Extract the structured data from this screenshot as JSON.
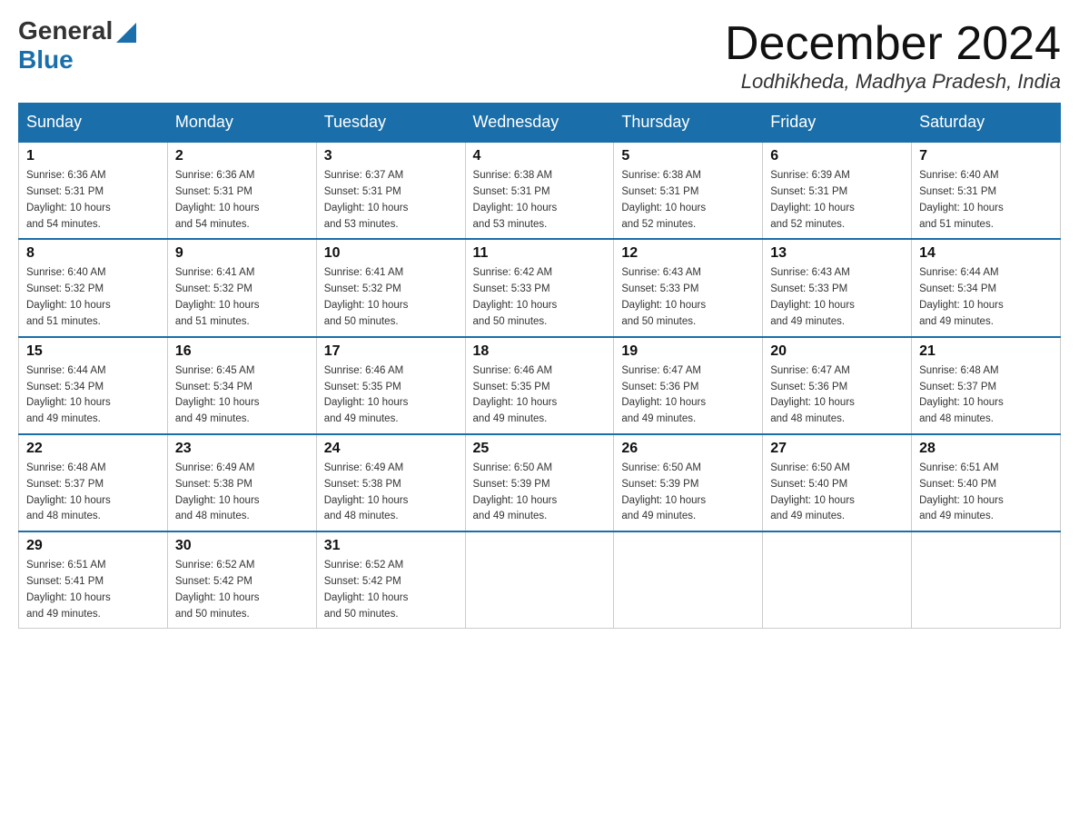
{
  "logo": {
    "general": "General",
    "blue": "Blue"
  },
  "title": "December 2024",
  "location": "Lodhikheda, Madhya Pradesh, India",
  "days_of_week": [
    "Sunday",
    "Monday",
    "Tuesday",
    "Wednesday",
    "Thursday",
    "Friday",
    "Saturday"
  ],
  "weeks": [
    [
      {
        "day": 1,
        "sunrise": "6:36 AM",
        "sunset": "5:31 PM",
        "daylight": "10 hours and 54 minutes."
      },
      {
        "day": 2,
        "sunrise": "6:36 AM",
        "sunset": "5:31 PM",
        "daylight": "10 hours and 54 minutes."
      },
      {
        "day": 3,
        "sunrise": "6:37 AM",
        "sunset": "5:31 PM",
        "daylight": "10 hours and 53 minutes."
      },
      {
        "day": 4,
        "sunrise": "6:38 AM",
        "sunset": "5:31 PM",
        "daylight": "10 hours and 53 minutes."
      },
      {
        "day": 5,
        "sunrise": "6:38 AM",
        "sunset": "5:31 PM",
        "daylight": "10 hours and 52 minutes."
      },
      {
        "day": 6,
        "sunrise": "6:39 AM",
        "sunset": "5:31 PM",
        "daylight": "10 hours and 52 minutes."
      },
      {
        "day": 7,
        "sunrise": "6:40 AM",
        "sunset": "5:31 PM",
        "daylight": "10 hours and 51 minutes."
      }
    ],
    [
      {
        "day": 8,
        "sunrise": "6:40 AM",
        "sunset": "5:32 PM",
        "daylight": "10 hours and 51 minutes."
      },
      {
        "day": 9,
        "sunrise": "6:41 AM",
        "sunset": "5:32 PM",
        "daylight": "10 hours and 51 minutes."
      },
      {
        "day": 10,
        "sunrise": "6:41 AM",
        "sunset": "5:32 PM",
        "daylight": "10 hours and 50 minutes."
      },
      {
        "day": 11,
        "sunrise": "6:42 AM",
        "sunset": "5:33 PM",
        "daylight": "10 hours and 50 minutes."
      },
      {
        "day": 12,
        "sunrise": "6:43 AM",
        "sunset": "5:33 PM",
        "daylight": "10 hours and 50 minutes."
      },
      {
        "day": 13,
        "sunrise": "6:43 AM",
        "sunset": "5:33 PM",
        "daylight": "10 hours and 49 minutes."
      },
      {
        "day": 14,
        "sunrise": "6:44 AM",
        "sunset": "5:34 PM",
        "daylight": "10 hours and 49 minutes."
      }
    ],
    [
      {
        "day": 15,
        "sunrise": "6:44 AM",
        "sunset": "5:34 PM",
        "daylight": "10 hours and 49 minutes."
      },
      {
        "day": 16,
        "sunrise": "6:45 AM",
        "sunset": "5:34 PM",
        "daylight": "10 hours and 49 minutes."
      },
      {
        "day": 17,
        "sunrise": "6:46 AM",
        "sunset": "5:35 PM",
        "daylight": "10 hours and 49 minutes."
      },
      {
        "day": 18,
        "sunrise": "6:46 AM",
        "sunset": "5:35 PM",
        "daylight": "10 hours and 49 minutes."
      },
      {
        "day": 19,
        "sunrise": "6:47 AM",
        "sunset": "5:36 PM",
        "daylight": "10 hours and 49 minutes."
      },
      {
        "day": 20,
        "sunrise": "6:47 AM",
        "sunset": "5:36 PM",
        "daylight": "10 hours and 48 minutes."
      },
      {
        "day": 21,
        "sunrise": "6:48 AM",
        "sunset": "5:37 PM",
        "daylight": "10 hours and 48 minutes."
      }
    ],
    [
      {
        "day": 22,
        "sunrise": "6:48 AM",
        "sunset": "5:37 PM",
        "daylight": "10 hours and 48 minutes."
      },
      {
        "day": 23,
        "sunrise": "6:49 AM",
        "sunset": "5:38 PM",
        "daylight": "10 hours and 48 minutes."
      },
      {
        "day": 24,
        "sunrise": "6:49 AM",
        "sunset": "5:38 PM",
        "daylight": "10 hours and 48 minutes."
      },
      {
        "day": 25,
        "sunrise": "6:50 AM",
        "sunset": "5:39 PM",
        "daylight": "10 hours and 49 minutes."
      },
      {
        "day": 26,
        "sunrise": "6:50 AM",
        "sunset": "5:39 PM",
        "daylight": "10 hours and 49 minutes."
      },
      {
        "day": 27,
        "sunrise": "6:50 AM",
        "sunset": "5:40 PM",
        "daylight": "10 hours and 49 minutes."
      },
      {
        "day": 28,
        "sunrise": "6:51 AM",
        "sunset": "5:40 PM",
        "daylight": "10 hours and 49 minutes."
      }
    ],
    [
      {
        "day": 29,
        "sunrise": "6:51 AM",
        "sunset": "5:41 PM",
        "daylight": "10 hours and 49 minutes."
      },
      {
        "day": 30,
        "sunrise": "6:52 AM",
        "sunset": "5:42 PM",
        "daylight": "10 hours and 50 minutes."
      },
      {
        "day": 31,
        "sunrise": "6:52 AM",
        "sunset": "5:42 PM",
        "daylight": "10 hours and 50 minutes."
      },
      null,
      null,
      null,
      null
    ]
  ],
  "labels": {
    "sunrise": "Sunrise:",
    "sunset": "Sunset:",
    "daylight": "Daylight:"
  }
}
